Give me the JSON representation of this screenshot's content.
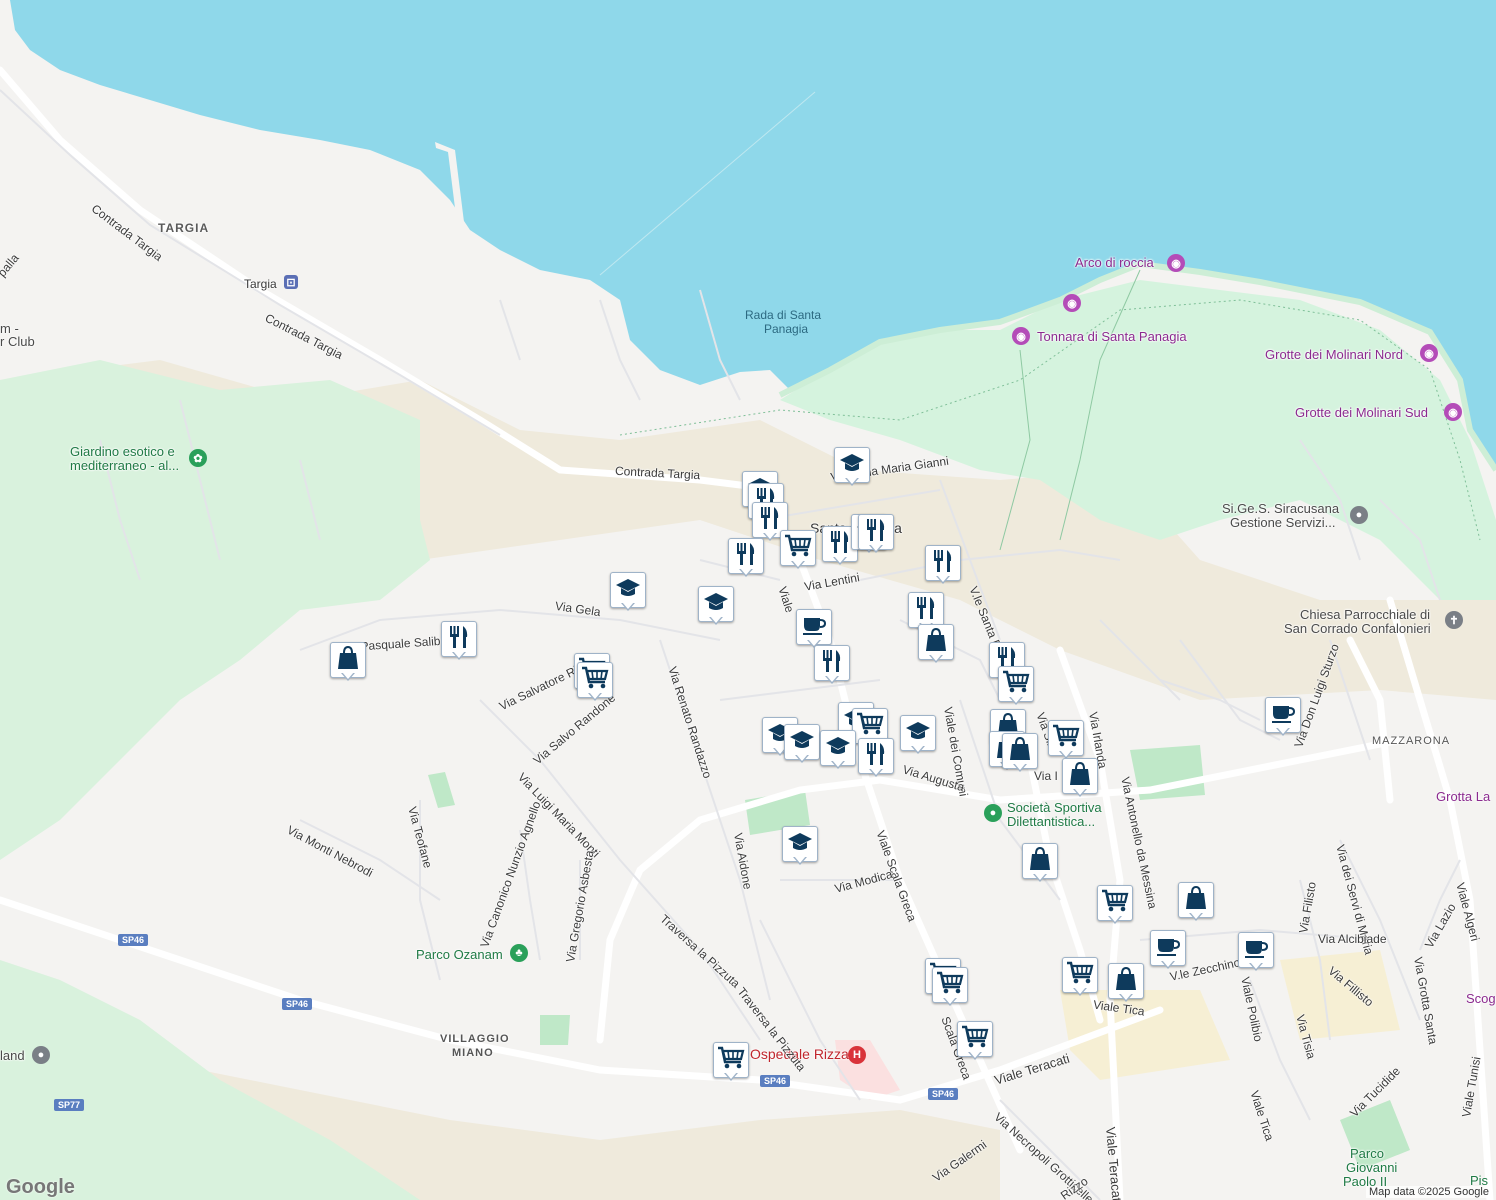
{
  "map": {
    "attribution": "Map data ©2025 Google",
    "logo": "Google"
  },
  "places": {
    "targia": "TARGIA",
    "targia_station": "Targia",
    "contrada_targia_1": "Contrada Targia",
    "contrada_targia_2": "Contrada Targia",
    "contrada_targia_3": "Contrada Targia",
    "giardino_1": "Giardino esotico e",
    "giardino_2": "mediterraneo - al...",
    "club_1": "m -",
    "club_2": "r Club",
    "palla": "palla",
    "rada_1": "Rada di Santa",
    "rada_2": "Panagia",
    "arco": "Arco di roccia",
    "tonnara": "Tonnara di Santa Panagia",
    "molinari_nord": "Grotte dei Molinari Nord",
    "molinari_sud": "Grotte dei Molinari Sud",
    "sigesi_1": "Si.Ge.S. Siracusana",
    "sigesi_2": "Gestione Servizi...",
    "chiesa_1": "Chiesa Parrocchiale di",
    "chiesa_2": "San Corrado Confalonieri",
    "mazzarona": "MAZZARONA",
    "grotta_la": "Grotta La",
    "santa_panagia": "Santa Panagia",
    "societa_1": "Società Sportiva",
    "societa_2": "Dilettantistica...",
    "parco_ozanam": "Parco Ozanam",
    "villaggio_1": "VILLAGGIO",
    "villaggio_2": "MIANO",
    "ospedale": "Ospedale Rizza",
    "land": "land",
    "parco_gp_1": "Parco",
    "parco_gp_2": "Giovanni",
    "parco_gp_3": "Paolo II",
    "scog": "Scog",
    "pis": "Pis"
  },
  "streets": {
    "via_gela": "Via Gela",
    "via_pasquale_salibra": "Via Pasquale Salibra",
    "via_salvatore": "Via Salvatore Ri",
    "via_salvo_randone": "Via Salvo Randone",
    "via_luigi_maria_monti": "Via Luigi Maria Monti",
    "via_renato_randazzo": "Via Renato Randazzo",
    "via_lentini": "Via Lentini",
    "viale": "Viale",
    "via_maria_gianni": "Via Anna Maria Gianni",
    "viale_santa_panagia": "V.le Santa Panag",
    "viale_dei_comuni": "Viale dei Comuni",
    "via_siracusa": "Via Sira",
    "via_irlanda": "Via Irlanda",
    "via_augusta": "Via Augusta",
    "viale_scala_greca": "Viale Scala Greca",
    "via_modica": "Via Modica",
    "via_aidone": "Via Aidone",
    "via_teofane": "Via Teofane",
    "via_monti_nebrodi": "Via Monti Nebrodi",
    "via_canonico": "Via Canonico Nunzio Agnello",
    "via_gregorio": "Via Gregorio Asbesta",
    "traversa_pizzuta_1": "Traversa la Pizzuta",
    "traversa_pizzuta_2": "Traversa la Pizzuta",
    "via_antonello": "Via Antonello da Messina",
    "via_don_luigi": "Via Don Luigi Sturzo",
    "via_servi": "Via dei Servi di Maria",
    "viale_algeri": "Viale Algeri",
    "via_lazio": "Via Lazio",
    "via_grotta_santa": "Via Grotta Santa",
    "via_filisto": "Via Filisto",
    "via_alcibiade": "Via Alcibiade",
    "via_fillisto": "Via Fillisto",
    "via_tisia": "Via Tisia",
    "viale_zecchino": "V.le Zecchino",
    "viale_polibio": "Viale Polibio",
    "viale_tica": "Viale Tica",
    "viale_tica_2": "Viale Tica",
    "viale_teracati": "Viale Teracati",
    "viale_teracati_2": "Viale Teracati",
    "via_tucidide": "Via Tucidide",
    "via_necropoli": "Via Necropoli Grotticelle",
    "via_galermi": "Via Galermi",
    "via_rizzo": "Rizzo",
    "viale_tunisi": "Viale Tunisi",
    "scala_greca_short": "Scala Greca",
    "via_ic": "Via I"
  },
  "roads": {
    "sp46_a": "SP46",
    "sp46_b": "SP46",
    "sp46_c": "SP46",
    "sp46_d": "SP46",
    "sp77": "SP77"
  },
  "colors": {
    "water": "#8fd8ea",
    "land": "#f4f3f1",
    "park": "#d5f3de",
    "sand": "#efeadc",
    "pin_fill": "#0e3a5c",
    "park_text": "#1f7a45",
    "attraction": "#8b2a8f",
    "hospital": "#c0262d"
  },
  "pin_types": [
    "school-icon",
    "restaurant-icon",
    "cart-icon",
    "shopping-bag-icon",
    "cafe-icon"
  ]
}
